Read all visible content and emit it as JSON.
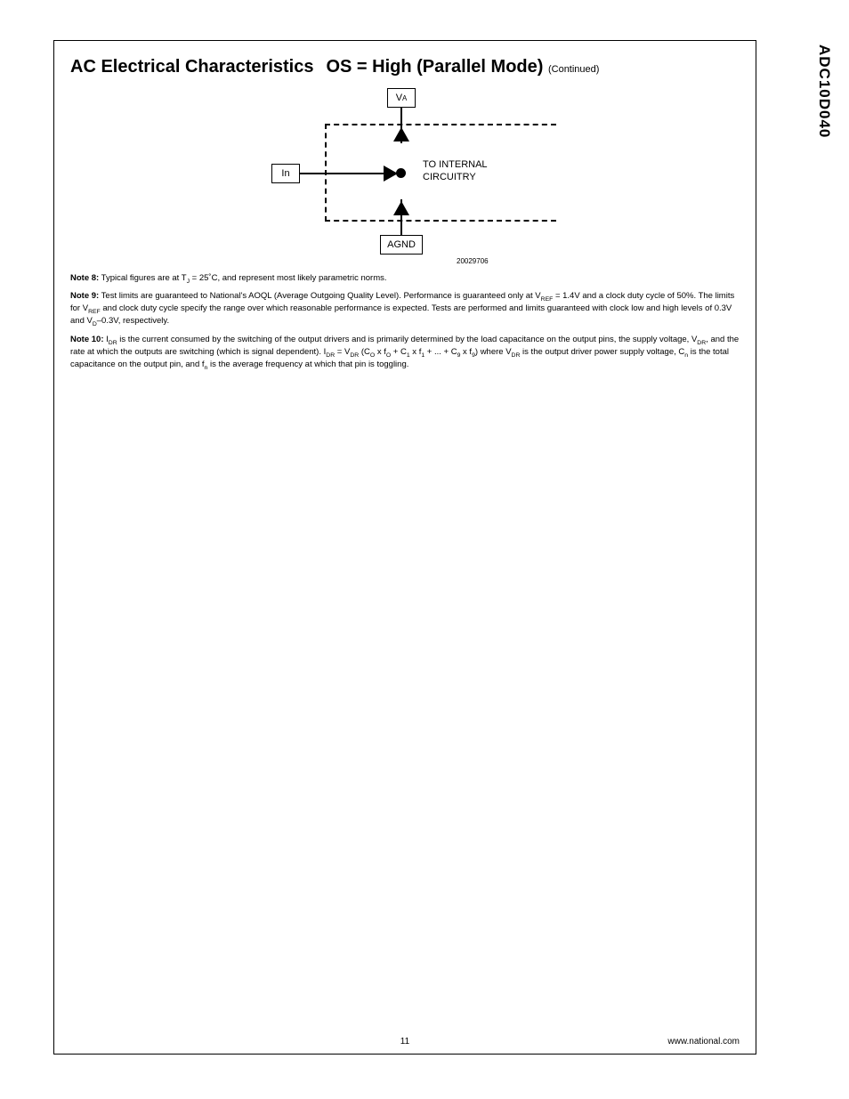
{
  "side_label": "ADC10D040",
  "title": {
    "main1": "AC Electrical Characteristics",
    "main2": "OS = High (Parallel Mode)",
    "continued": "(Continued)"
  },
  "diagram": {
    "va": "V",
    "va_sub": "A",
    "in": "In",
    "agnd": "AGND",
    "to_internal": "TO INTERNAL",
    "circuitry": "CIRCUITRY",
    "id": "20029706"
  },
  "notes": {
    "n8_label": "Note 8:",
    "n8_a": "Typical figures are at T",
    "n8_sub1": "J",
    "n8_b": " = 25˚C, and represent most likely parametric norms.",
    "n9_label": "Note 9:",
    "n9_a": "Test limits are guaranteed to National's AOQL (Average Outgoing Quality Level). Performance is guaranteed only at V",
    "n9_sub1": "REF",
    "n9_b": " = 1.4V and a clock duty cycle of 50%. The limits for V",
    "n9_sub2": "REF",
    "n9_c": " and clock duty cycle specify the range over which reasonable performance is expected. Tests are performed and limits guaranteed with clock low and high levels of 0.3V and V",
    "n9_sub3": "D",
    "n9_d": "–0.3V, respectively.",
    "n10_label": "Note 10:",
    "n10_a": "I",
    "n10_sub1": "DR",
    "n10_b": " is the current consumed by the switching of the output drivers and is primarily determined by the load capacitance on the output pins, the supply voltage, V",
    "n10_sub2": "DR",
    "n10_c": ", and the rate at which the outputs are switching (which is signal dependent). I",
    "n10_sub3": "DR",
    "n10_d": " = V",
    "n10_sub4": "DR",
    "n10_e": " (C",
    "n10_sub5": "O",
    "n10_f": " x f",
    "n10_sub6": "O",
    "n10_g": " + C",
    "n10_sub7": "1",
    "n10_h": " x f",
    "n10_sub8": "1",
    "n10_i": " + ... + C",
    "n10_sub9": "9",
    "n10_j": " x f",
    "n10_sub10": "9",
    "n10_k": ") where V",
    "n10_sub11": "DR",
    "n10_l": " is the output driver power supply voltage, C",
    "n10_sub12": "n",
    "n10_m": " is the total capacitance on the output pin, and f",
    "n10_sub13": "n",
    "n10_n": " is the average frequency at which that pin is toggling."
  },
  "footer": {
    "page": "11",
    "url": "www.national.com"
  }
}
